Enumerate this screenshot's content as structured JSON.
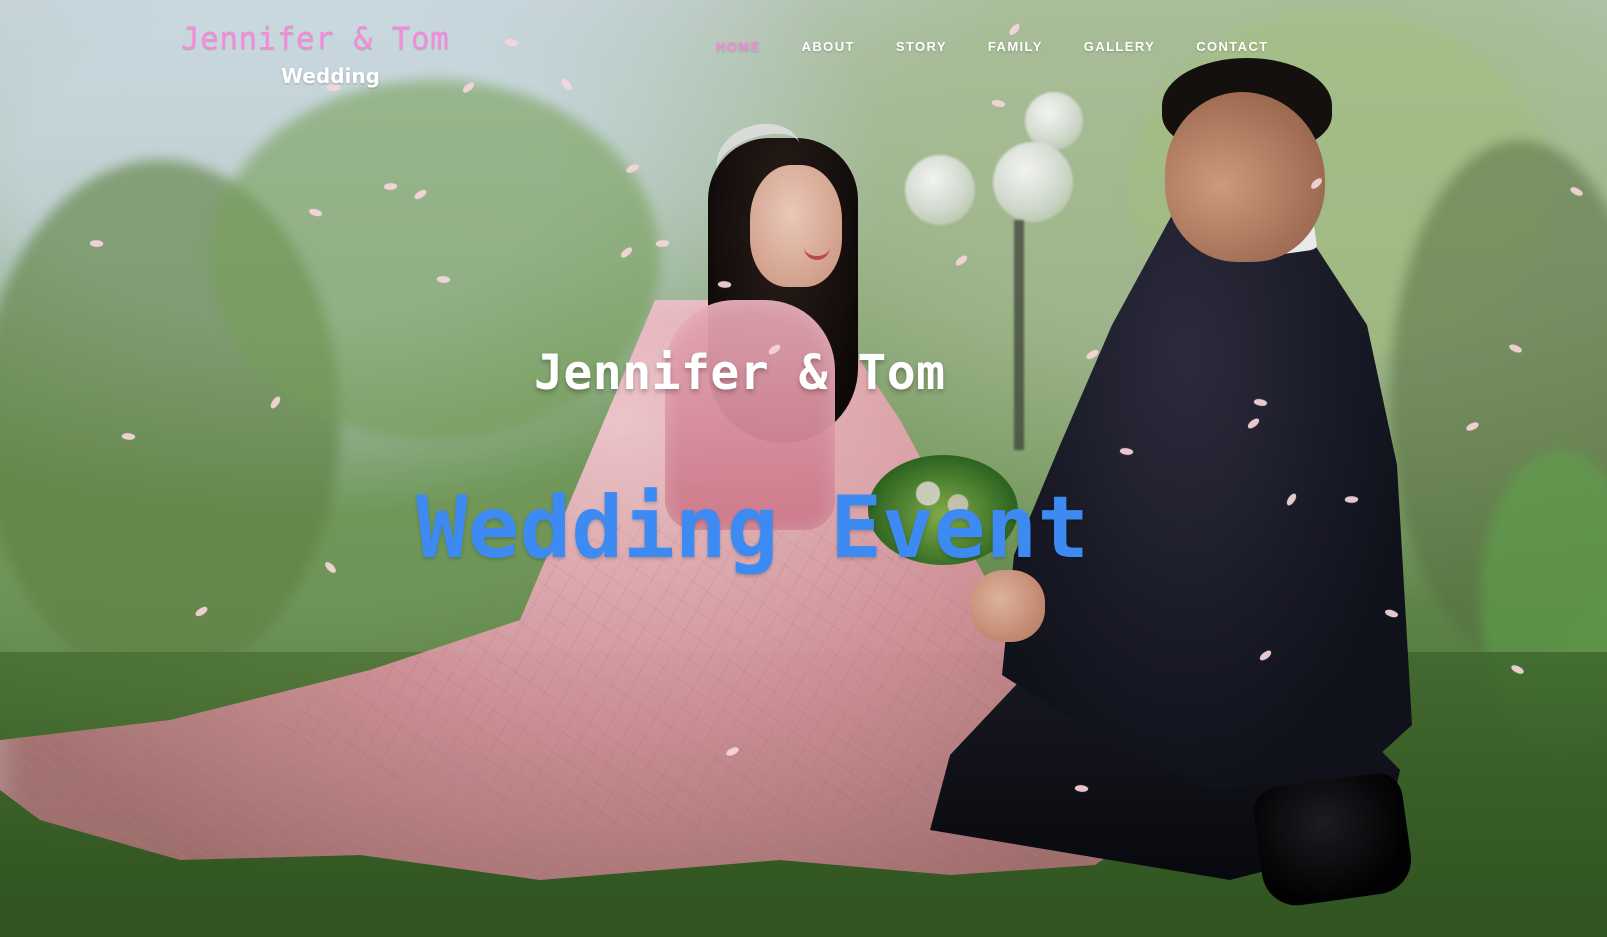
{
  "header": {
    "brand_names": "Jennifer & Tom",
    "brand_subtitle": "Wedding"
  },
  "nav": {
    "items": [
      {
        "label": "HOME",
        "active": true
      },
      {
        "label": "ABOUT",
        "active": false
      },
      {
        "label": "STORY",
        "active": false
      },
      {
        "label": "FAMILY",
        "active": false
      },
      {
        "label": "GALLERY",
        "active": false
      },
      {
        "label": "CONTACT",
        "active": false
      }
    ]
  },
  "hero": {
    "subtitle": "Jennifer & Tom",
    "title": "Wedding Event"
  },
  "colors": {
    "brand_pink": "#f58ad9",
    "hero_blue": "#3d8bf2",
    "white": "#ffffff"
  }
}
